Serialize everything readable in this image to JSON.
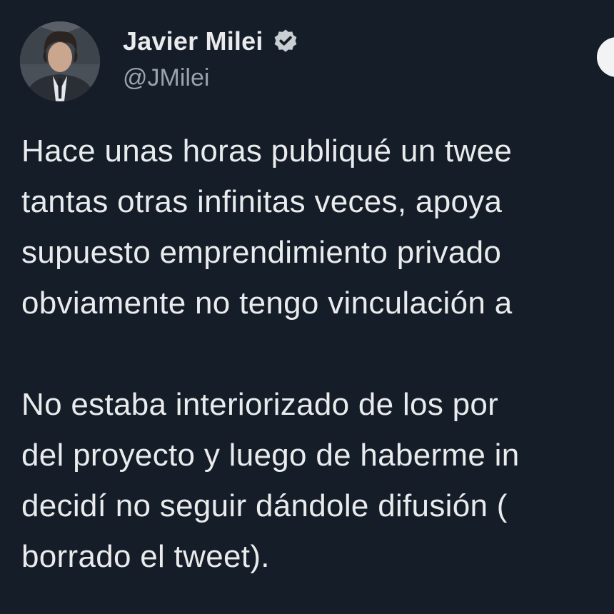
{
  "tweet": {
    "author": {
      "display_name": "Javier Milei",
      "handle": "@JMilei",
      "verified": true,
      "avatar_icon": "profile-photo",
      "verified_icon": "verified-badge-icon"
    },
    "follow_button": {
      "label": ""
    },
    "paragraphs": [
      {
        "lines": [
          "Hace unas horas publiqué un twee",
          "tantas otras infinitas veces, apoya",
          "supuesto emprendimiento privado",
          "obviamente no tengo vinculación a"
        ]
      },
      {
        "lines": [
          "No estaba interiorizado de los por",
          "del proyecto y luego de haberme in",
          "decidí no seguir dándole difusión (",
          "borrado el tweet)."
        ]
      }
    ]
  },
  "colors": {
    "background": "#151d28",
    "text_primary": "#e9ebec",
    "text_secondary": "#9aa3ac",
    "badge": "#c9ced3"
  }
}
